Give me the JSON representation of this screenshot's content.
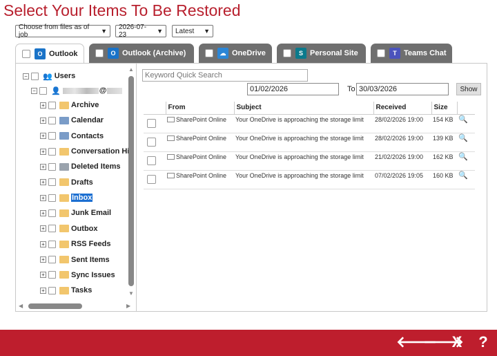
{
  "title": "Select Your Items To Be Restored",
  "filters": {
    "job_select": "Choose from files as of job",
    "date_select": "2026-07-23",
    "version_select": "Latest"
  },
  "tabs": [
    {
      "label": "Outlook",
      "icon": "outlook-icon",
      "active": true
    },
    {
      "label": "Outlook (Archive)",
      "icon": "outlook-icon",
      "active": false
    },
    {
      "label": "OneDrive",
      "icon": "onedrive-icon",
      "active": false
    },
    {
      "label": "Personal Site",
      "icon": "sharepoint-icon",
      "active": false
    },
    {
      "label": "Teams Chat",
      "icon": "teams-icon",
      "active": false
    }
  ],
  "tree": {
    "root_label": "Users",
    "user_label": "@",
    "folders": [
      {
        "label": "Archive",
        "icon": "folder-icon"
      },
      {
        "label": "Calendar",
        "icon": "calendar-icon"
      },
      {
        "label": "Contacts",
        "icon": "contacts-icon"
      },
      {
        "label": "Conversation Hi",
        "icon": "folder-icon"
      },
      {
        "label": "Deleted Items",
        "icon": "trash-icon"
      },
      {
        "label": "Drafts",
        "icon": "drafts-icon"
      },
      {
        "label": "Inbox",
        "icon": "inbox-icon"
      },
      {
        "label": "Junk Email",
        "icon": "junk-icon"
      },
      {
        "label": "Outbox",
        "icon": "outbox-icon"
      },
      {
        "label": "RSS Feeds",
        "icon": "folder-icon"
      },
      {
        "label": "Sent Items",
        "icon": "sent-icon"
      },
      {
        "label": "Sync Issues",
        "icon": "folder-icon"
      },
      {
        "label": "Tasks",
        "icon": "tasks-icon"
      }
    ]
  },
  "search": {
    "placeholder": "Keyword Quick Search"
  },
  "date_from": "01/02/2026",
  "to_label": "To",
  "date_to": "30/03/2026",
  "show_label": "Show",
  "table": {
    "headers": [
      "From",
      "Subject",
      "Received",
      "Size"
    ],
    "rows": [
      {
        "from": "SharePoint Online",
        "subject": "Your OneDrive is approaching the storage limit",
        "received": "28/02/2026 19:00",
        "size": "154 KB"
      },
      {
        "from": "SharePoint Online",
        "subject": "Your OneDrive is approaching the storage limit",
        "received": "28/02/2026 19:00",
        "size": "139 KB"
      },
      {
        "from": "SharePoint Online",
        "subject": "Your OneDrive is approaching the storage limit",
        "received": "21/02/2026 19:00",
        "size": "162 KB"
      },
      {
        "from": "SharePoint Online",
        "subject": "Your OneDrive is approaching the storage limit",
        "received": "07/02/2026 19:05",
        "size": "160 KB"
      }
    ]
  },
  "footer": {
    "back": "🡐",
    "forward": "🡒",
    "close": "X",
    "help": "?"
  },
  "colors": {
    "brand": "#be1e2d",
    "title": "#b8202e",
    "tab_inactive": "#6f6f6f",
    "selection": "#1c6fd1"
  }
}
